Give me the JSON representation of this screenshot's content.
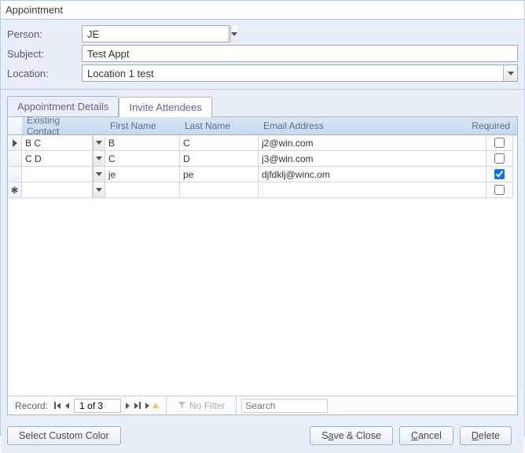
{
  "window": {
    "title": "Appointment"
  },
  "form": {
    "person_label": "Person:",
    "person_value": "JE",
    "subject_label": "Subject:",
    "subject_value": "Test Appt",
    "location_label": "Location:",
    "location_value": "Location 1 test"
  },
  "tabs": {
    "details": "Appointment Details",
    "invite": "Invite Attendees"
  },
  "grid": {
    "headers": {
      "contact": "Existing Contact",
      "first": "First Name",
      "last": "Last Name",
      "email": "Email Address",
      "required": "Required"
    },
    "rows": [
      {
        "contact": "B C",
        "first": "B",
        "last": "C",
        "email": "j2@win.com",
        "required": false,
        "pointer": true
      },
      {
        "contact": "C D",
        "first": "C",
        "last": "D",
        "email": "j3@win.com",
        "required": false,
        "pointer": false
      },
      {
        "contact": "",
        "first": "je",
        "last": "pe",
        "email": "djfdklj@winc.om",
        "required": true,
        "pointer": false
      }
    ],
    "new_row_marker": "✱"
  },
  "record_nav": {
    "label": "Record:",
    "position": "1 of 3",
    "no_filter": "No Filter",
    "search_placeholder": "Search"
  },
  "buttons": {
    "custom_color": "Select Custom Color",
    "save_close_pre": "S",
    "save_close_u": "a",
    "save_close_post": "ve & Close",
    "cancel_u": "C",
    "cancel_post": "ancel",
    "delete_u": "D",
    "delete_post": "elete"
  }
}
